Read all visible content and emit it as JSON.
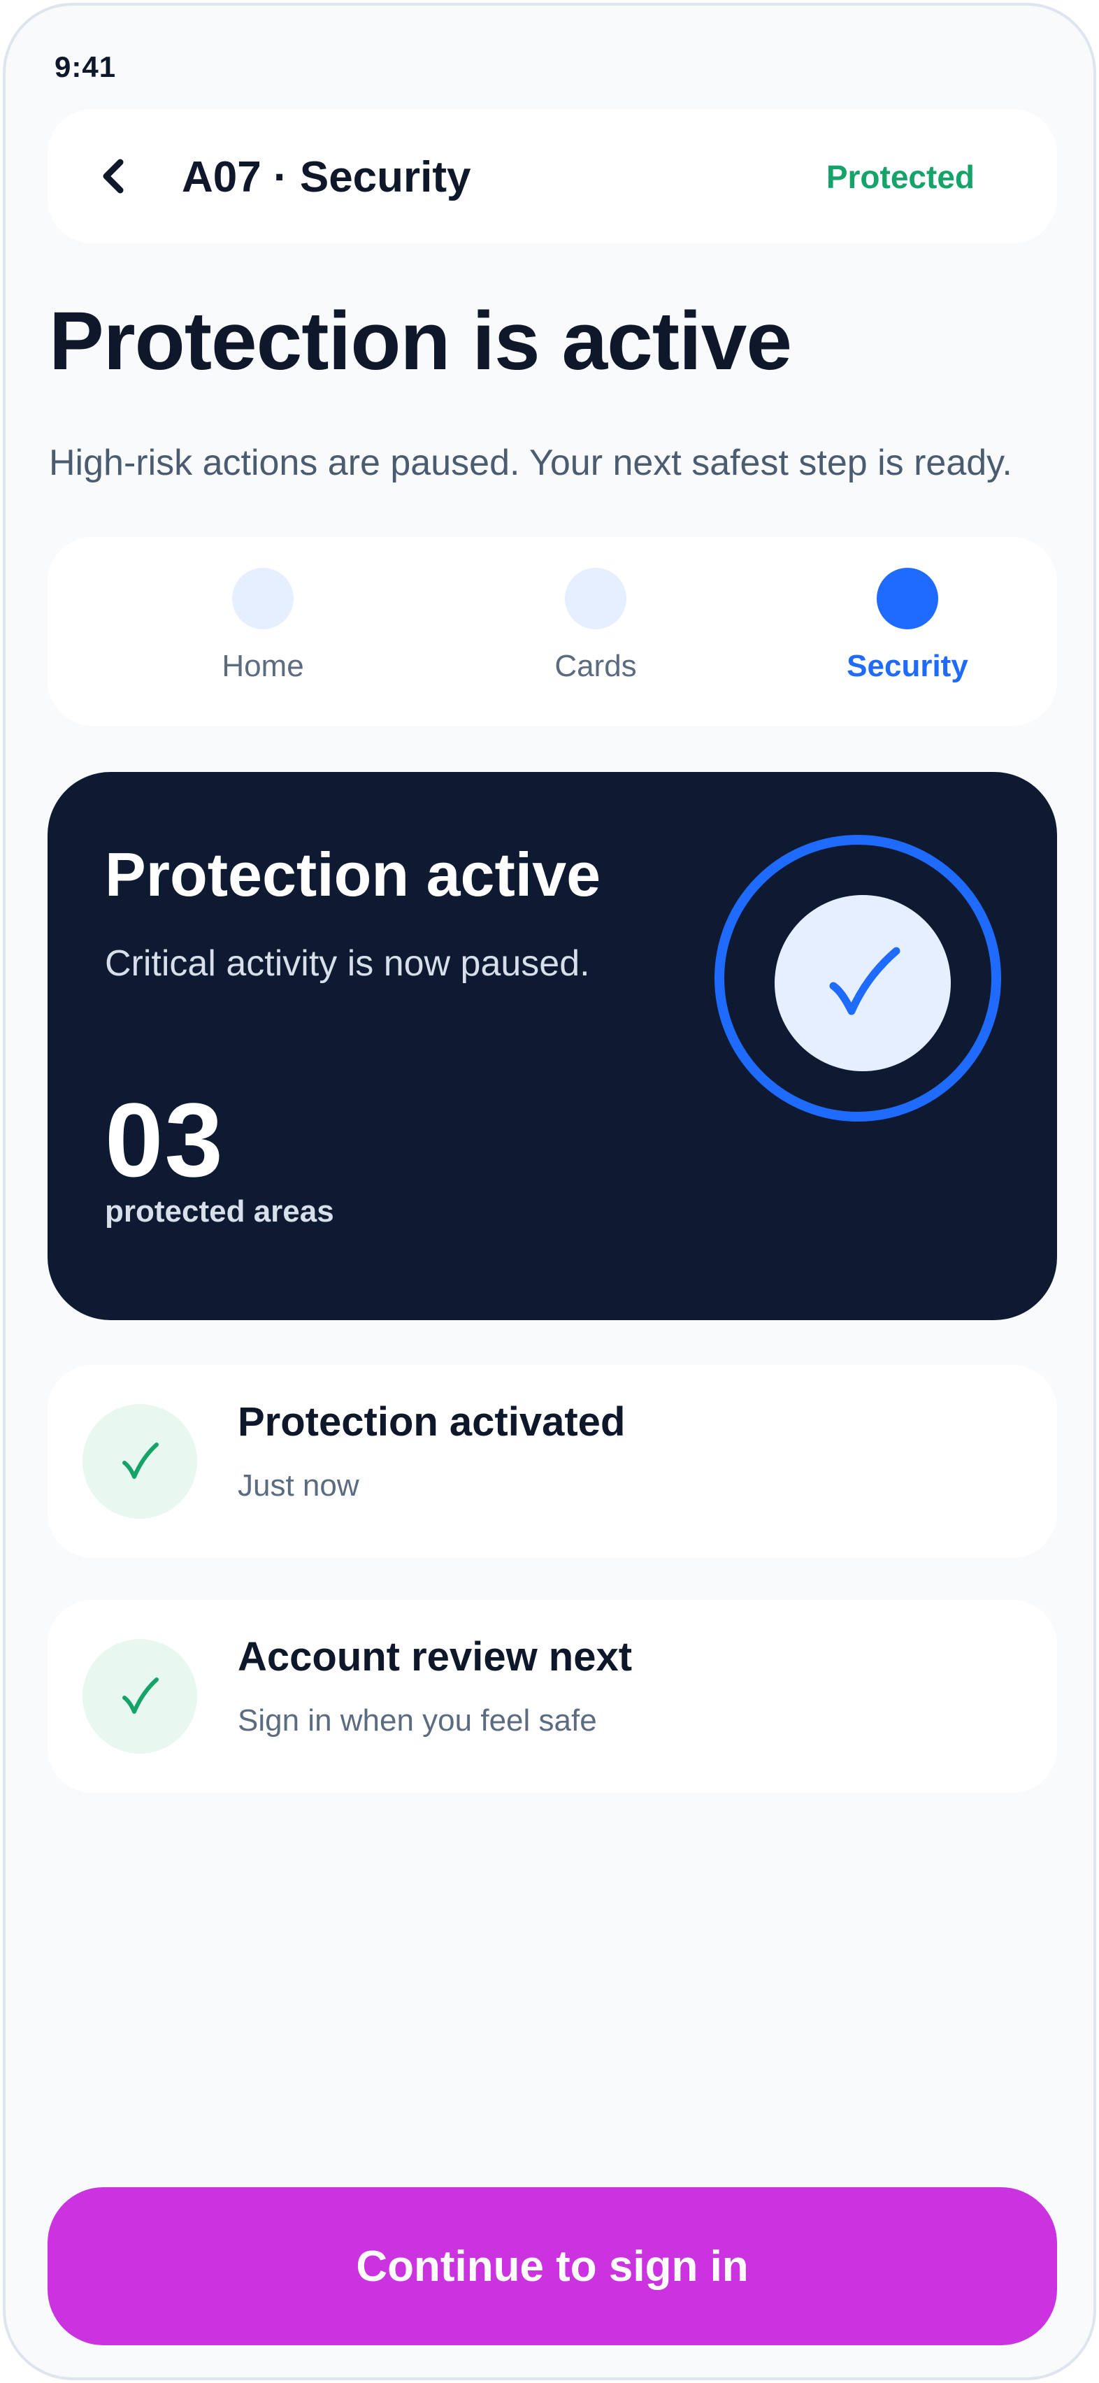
{
  "status_bar": {
    "time": "9:41"
  },
  "header": {
    "back_icon": "chevron-left-icon",
    "title": "A07 · Security",
    "status": "Protected"
  },
  "page": {
    "title": "Protection is active",
    "subtitle": "High-risk actions are paused. Your next safest step is ready."
  },
  "tabs": [
    {
      "label": "Home",
      "active": false
    },
    {
      "label": "Cards",
      "active": false
    },
    {
      "label": "Security",
      "active": true
    }
  ],
  "hero": {
    "title": "Protection active",
    "subtitle": "Critical activity is now paused.",
    "count": "03",
    "count_label": "protected areas",
    "icon": "check-icon"
  },
  "steps": [
    {
      "title": "Protection activated",
      "subtitle": "Just now",
      "icon": "check-icon"
    },
    {
      "title": "Account review next",
      "subtitle": "Sign in when you feel safe",
      "icon": "check-icon"
    }
  ],
  "cta": {
    "label": "Continue to sign in"
  },
  "colors": {
    "background": "#f8fafc",
    "accent_blue": "#1f6bff",
    "success_green": "#16a36a",
    "hero_bg": "#0e1a31",
    "cta": "#cb32e0"
  }
}
